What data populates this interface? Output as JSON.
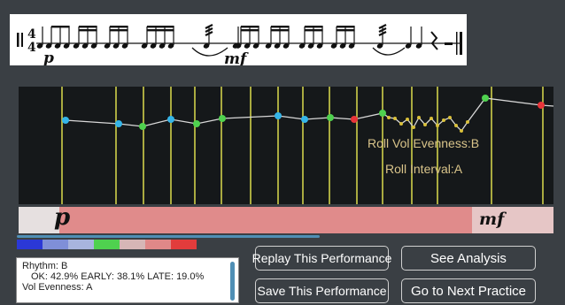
{
  "score": {
    "time_signature": {
      "numerator": "4",
      "denominator": "4"
    },
    "dynamic_start": "p",
    "dynamic_mid": "mf"
  },
  "analysis": {
    "roll_evenness": "Roll Vol Evenness:B",
    "roll_interval": "Roll Interval:A"
  },
  "dynamics_bar": {
    "start_marking": "p",
    "end_marking": "mf"
  },
  "legend_colors": [
    "#2b38d6",
    "#7f8fd8",
    "#a8b4de",
    "#4fd14f",
    "#d6b6b6",
    "#e08888",
    "#e23c3c"
  ],
  "point_colors": {
    "on_time": "#4fd14f",
    "early": "#35b5e8",
    "late": "#e8353a",
    "roll": "#d9c03a"
  },
  "info": {
    "rhythm": "Rhythm: B",
    "timing": "OK: 42.9%   EARLY: 38.1%   LATE: 19.0%",
    "vol_evenness": "Vol Evenness: A"
  },
  "buttons": {
    "replay": "Replay This Performance",
    "analysis": "See Analysis",
    "save": "Save This Performance",
    "next": "Go to Next Practice"
  }
}
